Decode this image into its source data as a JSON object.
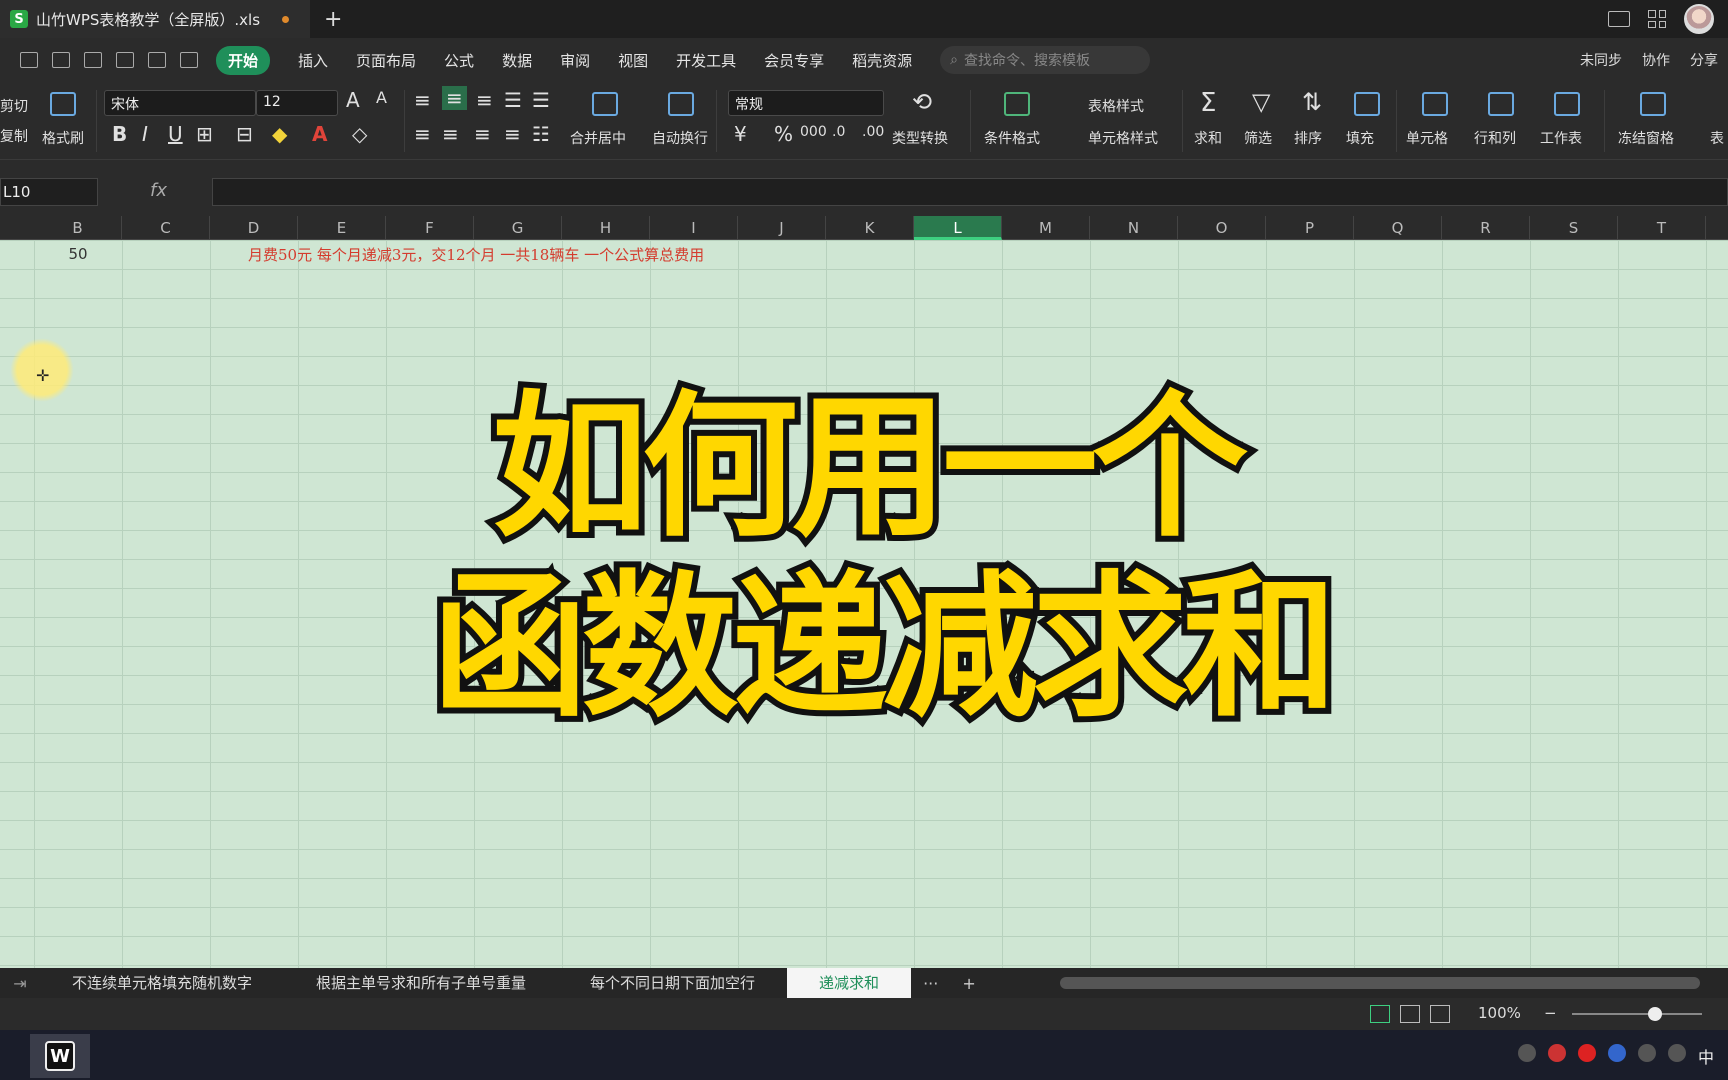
{
  "titlebar": {
    "doc_title": "山竹WPS表格教学（全屏版）.xls",
    "new_tab": "+"
  },
  "menubar": {
    "items": [
      "开始",
      "插入",
      "页面布局",
      "公式",
      "数据",
      "审阅",
      "视图",
      "开发工具",
      "会员专享",
      "稻壳资源"
    ],
    "search_placeholder": "查找命令、搜索模板",
    "right": [
      "未同步",
      "协作",
      "分享"
    ]
  },
  "ribbon": {
    "cut": "剪切",
    "copy": "复制",
    "format_painter": "格式刷",
    "font_name": "宋体",
    "font_size": "12",
    "merge_center": "合并居中",
    "wrap_text": "自动换行",
    "number_format": "常规",
    "type_convert": "类型转换",
    "conditional_format": "条件格式",
    "table_style": "表格样式",
    "cell_style": "单元格样式",
    "sum": "求和",
    "filter": "筛选",
    "sort": "排序",
    "fill": "填充",
    "cell": "单元格",
    "row_col": "行和列",
    "worksheet": "工作表",
    "freeze": "冻结窗格",
    "more": "表"
  },
  "formula_bar": {
    "name_box": "L10",
    "fx": "fx",
    "value": ""
  },
  "columns": [
    "B",
    "C",
    "D",
    "E",
    "F",
    "G",
    "H",
    "I",
    "J",
    "K",
    "L",
    "M",
    "N",
    "O",
    "P",
    "Q",
    "R",
    "S",
    "T"
  ],
  "selected_column": "L",
  "cells": {
    "b1": "50",
    "note": "月费50元  每个月递减3元，交12个月  一共18辆车  一个公式算总费用"
  },
  "overlay": {
    "line1": "如何用一个",
    "line2": "函数递减求和"
  },
  "sheet_tabs": {
    "tabs": [
      "不连续单元格填充随机数字",
      "根据主单号求和所有子单号重量",
      "每个不同日期下面加空行",
      "递减求和"
    ],
    "active_index": 3,
    "more": "···",
    "add": "+"
  },
  "statusbar": {
    "zoom": "100%"
  },
  "taskbar": {
    "ime": "中"
  },
  "colors": {
    "sheet_bg": "#cfe6d3",
    "accent": "#1f8f5a",
    "note_red": "#d43c2e",
    "overlay_yellow": "#ffd700"
  }
}
